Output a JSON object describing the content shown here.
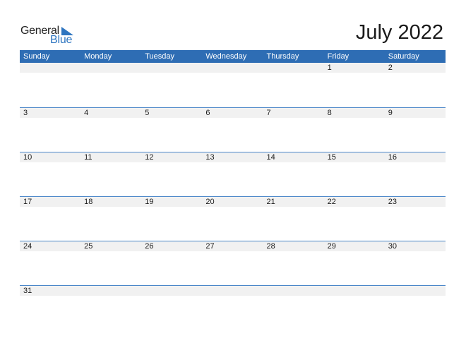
{
  "logo": {
    "word1": "General",
    "word2": "Blue"
  },
  "title": "July 2022",
  "colors": {
    "header_bg": "#2e6db4",
    "accent": "#2e75c0",
    "row_strip": "#f1f1f1"
  },
  "weekdays": [
    "Sunday",
    "Monday",
    "Tuesday",
    "Wednesday",
    "Thursday",
    "Friday",
    "Saturday"
  ],
  "weeks": [
    [
      "",
      "",
      "",
      "",
      "",
      "1",
      "2"
    ],
    [
      "3",
      "4",
      "5",
      "6",
      "7",
      "8",
      "9"
    ],
    [
      "10",
      "11",
      "12",
      "13",
      "14",
      "15",
      "16"
    ],
    [
      "17",
      "18",
      "19",
      "20",
      "21",
      "22",
      "23"
    ],
    [
      "24",
      "25",
      "26",
      "27",
      "28",
      "29",
      "30"
    ],
    [
      "31",
      "",
      "",
      "",
      "",
      "",
      ""
    ]
  ]
}
